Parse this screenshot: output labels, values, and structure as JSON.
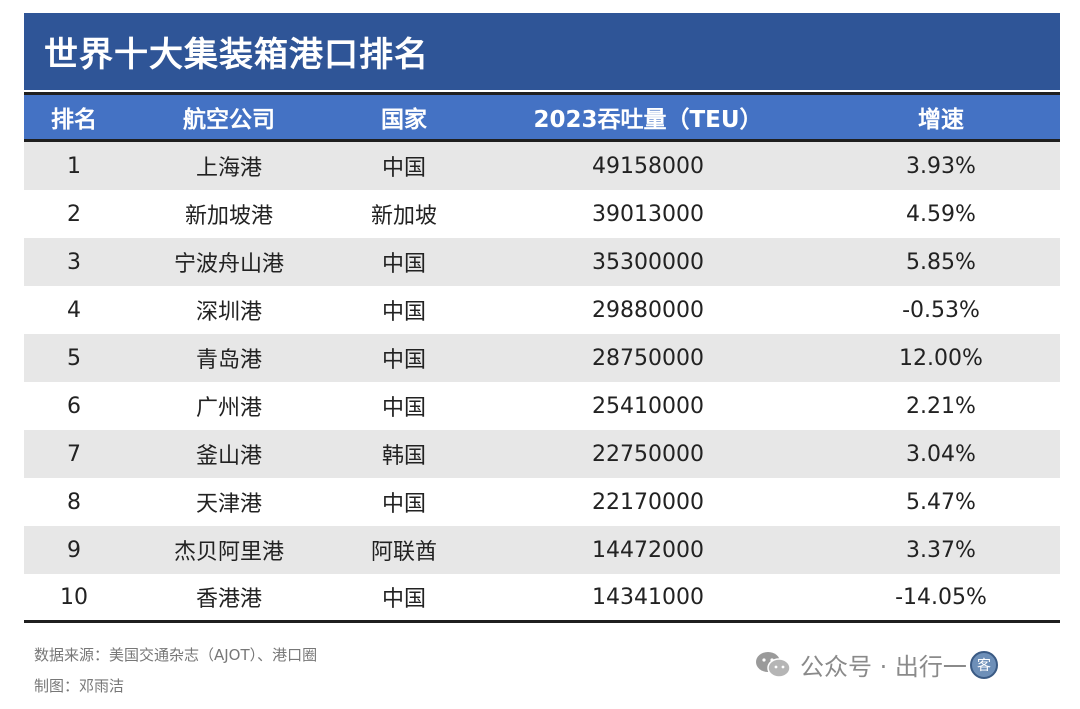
{
  "title": "世界十大集装箱港口排名",
  "columns": {
    "rank": "排名",
    "port": "航空公司",
    "country": "国家",
    "teu": "2023吞吐量（TEU）",
    "growth": "增速"
  },
  "rows": [
    {
      "rank": "1",
      "port": "上海港",
      "country": "中国",
      "teu": "49158000",
      "growth": "3.93%"
    },
    {
      "rank": "2",
      "port": "新加坡港",
      "country": "新加坡",
      "teu": "39013000",
      "growth": "4.59%"
    },
    {
      "rank": "3",
      "port": "宁波舟山港",
      "country": "中国",
      "teu": "35300000",
      "growth": "5.85%"
    },
    {
      "rank": "4",
      "port": "深圳港",
      "country": "中国",
      "teu": "29880000",
      "growth": "-0.53%"
    },
    {
      "rank": "5",
      "port": "青岛港",
      "country": "中国",
      "teu": "28750000",
      "growth": "12.00%"
    },
    {
      "rank": "6",
      "port": "广州港",
      "country": "中国",
      "teu": "25410000",
      "growth": "2.21%"
    },
    {
      "rank": "7",
      "port": "釜山港",
      "country": "韩国",
      "teu": "22750000",
      "growth": "3.04%"
    },
    {
      "rank": "8",
      "port": "天津港",
      "country": "中国",
      "teu": "22170000",
      "growth": "5.47%"
    },
    {
      "rank": "9",
      "port": "杰贝阿里港",
      "country": "阿联酋",
      "teu": "14472000",
      "growth": "3.37%"
    },
    {
      "rank": "10",
      "port": "香港港",
      "country": "中国",
      "teu": "14341000",
      "growth": "-14.05%"
    }
  ],
  "footer": {
    "source": "数据来源：美国交通杂志（AJOT）、港口圈",
    "author": "制图：邓雨洁"
  },
  "watermark": {
    "text": "公众号 · 出行一",
    "logo_char": "客",
    "icon": "wechat-icon"
  },
  "colors": {
    "title_bg": "#2f5597",
    "header_bg": "#4472c4",
    "shaded_row": "#e7e7e7"
  }
}
